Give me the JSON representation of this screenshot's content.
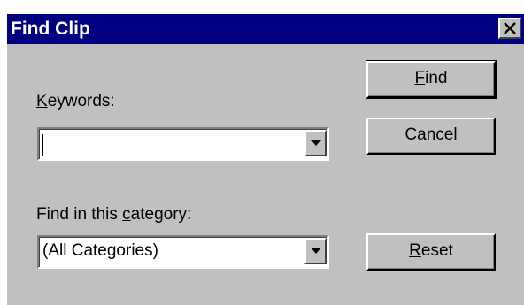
{
  "window": {
    "title": "Find Clip"
  },
  "keywords": {
    "label_accel": "K",
    "label_rest": "eywords:",
    "value": ""
  },
  "category": {
    "label_pre": "Find in this ",
    "label_accel": "c",
    "label_post": "ategory:",
    "value": "(All Categories)"
  },
  "buttons": {
    "find_accel": "F",
    "find_rest": "ind",
    "cancel": "Cancel",
    "reset_accel": "R",
    "reset_rest": "eset"
  },
  "icons": {
    "close": "close-x-icon",
    "dropdown": "down-triangle-icon"
  },
  "colors": {
    "title_bar": "#000080",
    "face": "#c0c0c0"
  }
}
